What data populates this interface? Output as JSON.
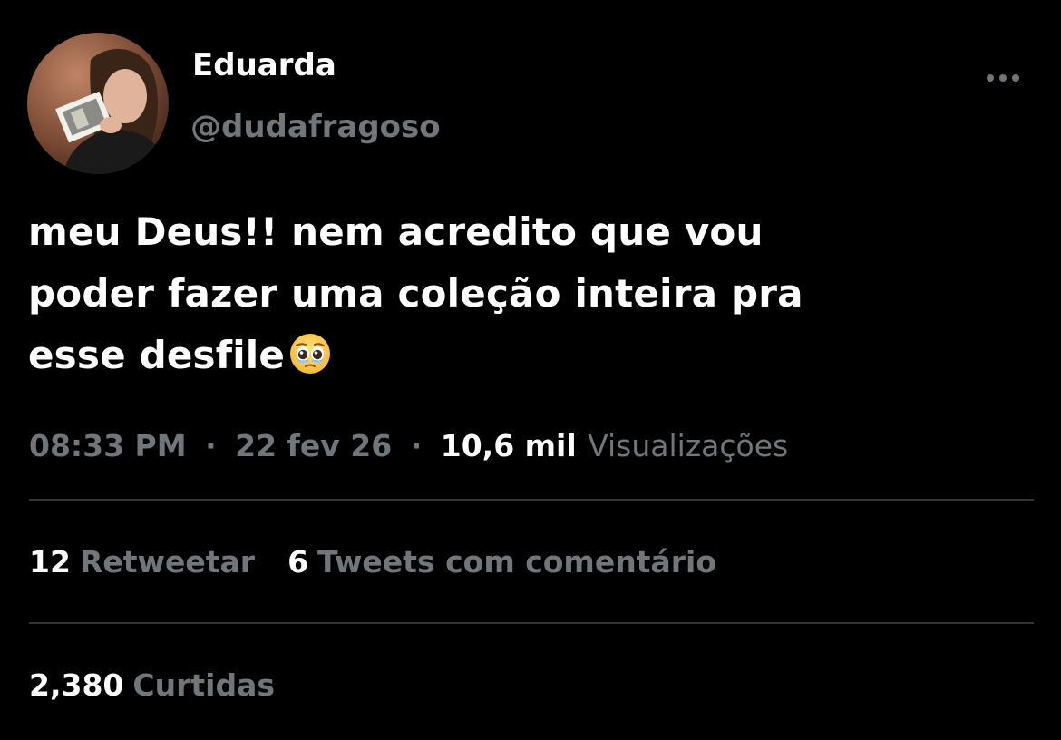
{
  "user": {
    "display_name": "Eduarda",
    "handle": "@dudafragoso"
  },
  "tweet": {
    "lines": [
      "meu Deus!! nem acredito que vou",
      "poder fazer uma coleção inteira pra",
      "esse desfile"
    ],
    "emoji": "pleading-face"
  },
  "meta": {
    "time": "08:33 PM",
    "separator": "·",
    "date": "22 fev 26",
    "views_count": "10,6 mil",
    "views_label": "Visualizações"
  },
  "stats": {
    "retweets_count": "12",
    "retweets_label": "Retweetar",
    "quotes_count": "6",
    "quotes_label": "Tweets com comentário",
    "likes_count": "2,380",
    "likes_label": "Curtidas"
  },
  "colors": {
    "background": "#000000",
    "text_primary": "#ffffff",
    "text_secondary": "#71767b",
    "divider": "#2f3336"
  }
}
